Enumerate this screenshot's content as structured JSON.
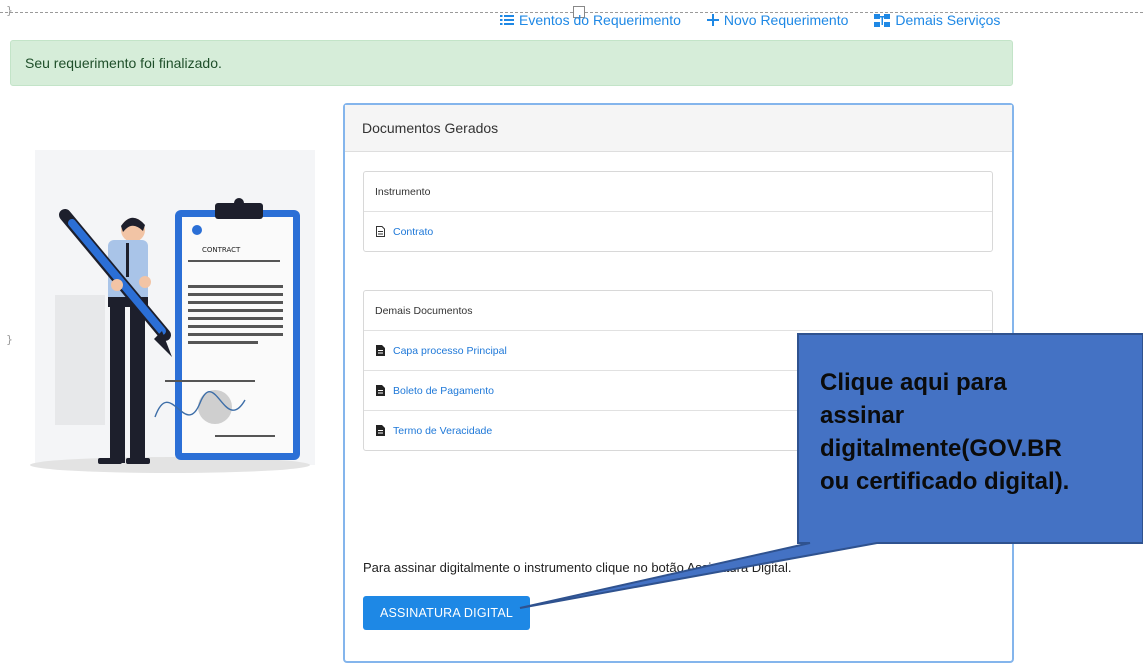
{
  "topnav": {
    "events_label": "Eventos do Requerimento",
    "new_label": "Novo Requerimento",
    "services_label": "Demais Serviços"
  },
  "alert": {
    "message": "Seu requerimento foi finalizado."
  },
  "illustration": {
    "contract_label": "CONTRACT"
  },
  "panel": {
    "title": "Documentos Gerados",
    "instrument": {
      "header": "Instrumento",
      "items": [
        {
          "label": "Contrato"
        }
      ]
    },
    "other_docs": {
      "header": "Demais Documentos",
      "items": [
        {
          "label": "Capa processo Principal"
        },
        {
          "label": "Boleto de Pagamento"
        },
        {
          "label": "Termo de Veracidade"
        }
      ]
    },
    "instruction": "Para assinar digitalmente o instrumento clique no botão Assinatura Digital.",
    "sign_button_label": "ASSINATURA DIGITAL"
  },
  "callout": {
    "lines": [
      "Clique aqui para",
      "assinar",
      "digitalmente(GOV.BR",
      "ou certificado digital)."
    ],
    "color": "#4472c4"
  },
  "colors": {
    "accent": "#1e88e5",
    "alert_bg": "#d6edd9",
    "panel_border": "#84b5ec"
  }
}
